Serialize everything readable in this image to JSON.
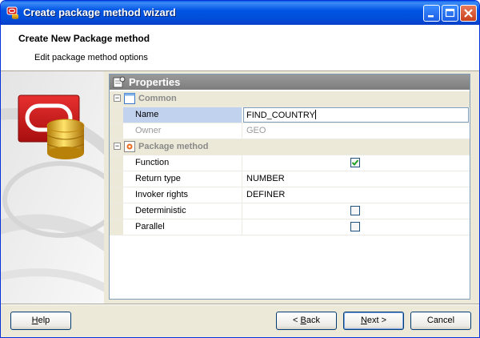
{
  "window": {
    "title": "Create package method wizard"
  },
  "header": {
    "title": "Create New Package method",
    "subtitle": "Edit package method options"
  },
  "properties": {
    "title": "Properties",
    "categories": [
      {
        "label": "Common",
        "rows": [
          {
            "name": "Name",
            "value": "FIND_COUNTRY",
            "editing": true,
            "selected": true
          },
          {
            "name": "Owner",
            "value": "GEO",
            "disabled": true
          }
        ]
      },
      {
        "label": "Package method",
        "rows": [
          {
            "name": "Function",
            "checked": true
          },
          {
            "name": "Return type",
            "value": "NUMBER"
          },
          {
            "name": "Invoker rights",
            "value": "DEFINER"
          },
          {
            "name": "Deterministic",
            "checked": false
          },
          {
            "name": "Parallel",
            "checked": false
          }
        ]
      }
    ]
  },
  "buttons": {
    "help_u": "H",
    "help_rest": "elp",
    "back_pre": "< ",
    "back_u": "B",
    "back_rest": "ack",
    "next_u": "N",
    "next_rest": "ext >",
    "cancel": "Cancel"
  },
  "colors": {
    "titlebar": "#0054e3",
    "accent_red": "#d42020",
    "database_gold": "#e8b820",
    "selection": "#c1d2ee"
  }
}
